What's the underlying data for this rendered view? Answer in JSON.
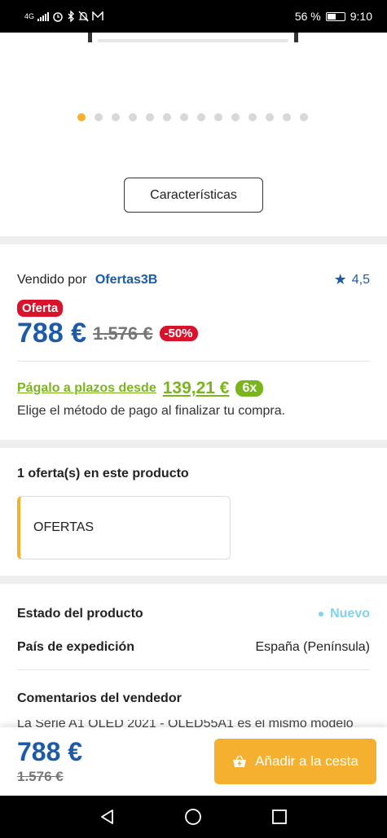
{
  "status_bar": {
    "network": "4G",
    "battery": "56 %",
    "battery_level": 0.56,
    "time": "9:10",
    "icons": [
      "signal-icon",
      "alarm-icon",
      "bluetooth-icon",
      "mute-icon",
      "mail-icon"
    ]
  },
  "gallery": {
    "dot_count": 14,
    "active_index": 0,
    "features_button": "Características"
  },
  "seller": {
    "label": "Vendido por",
    "name": "Ofertas3B",
    "rating": "4,5"
  },
  "price": {
    "badge": "Oferta",
    "current": "788 €",
    "old": "1.576 €",
    "discount": "-50%"
  },
  "installments": {
    "text": "Págalo a plazos desde",
    "amount": "139,21 €",
    "badge": "6x",
    "note": "Elige el método de pago al finalizar tu compra."
  },
  "offers": {
    "title": "1 oferta(s) en este producto",
    "box_label": "OFERTAS"
  },
  "details": {
    "state_label": "Estado del producto",
    "state_value": "Nuevo",
    "country_label": "País de expedición",
    "country_value": "España (Península)",
    "comments_title": "Comentarios del vendedor",
    "comments_text": "La Serie A1 OLED 2021 - OLED55A1 es el mismo modelo"
  },
  "bottom_bar": {
    "price": "788 €",
    "old_price": "1.576 €",
    "add_button": "Añadir a la cesta"
  },
  "colors": {
    "brand_blue": "#1d5aa8",
    "accent_yellow": "#f4b02e",
    "sale_red": "#d9132b",
    "installments_green": "#7ab51d",
    "new_cyan": "#7fd3ec"
  }
}
